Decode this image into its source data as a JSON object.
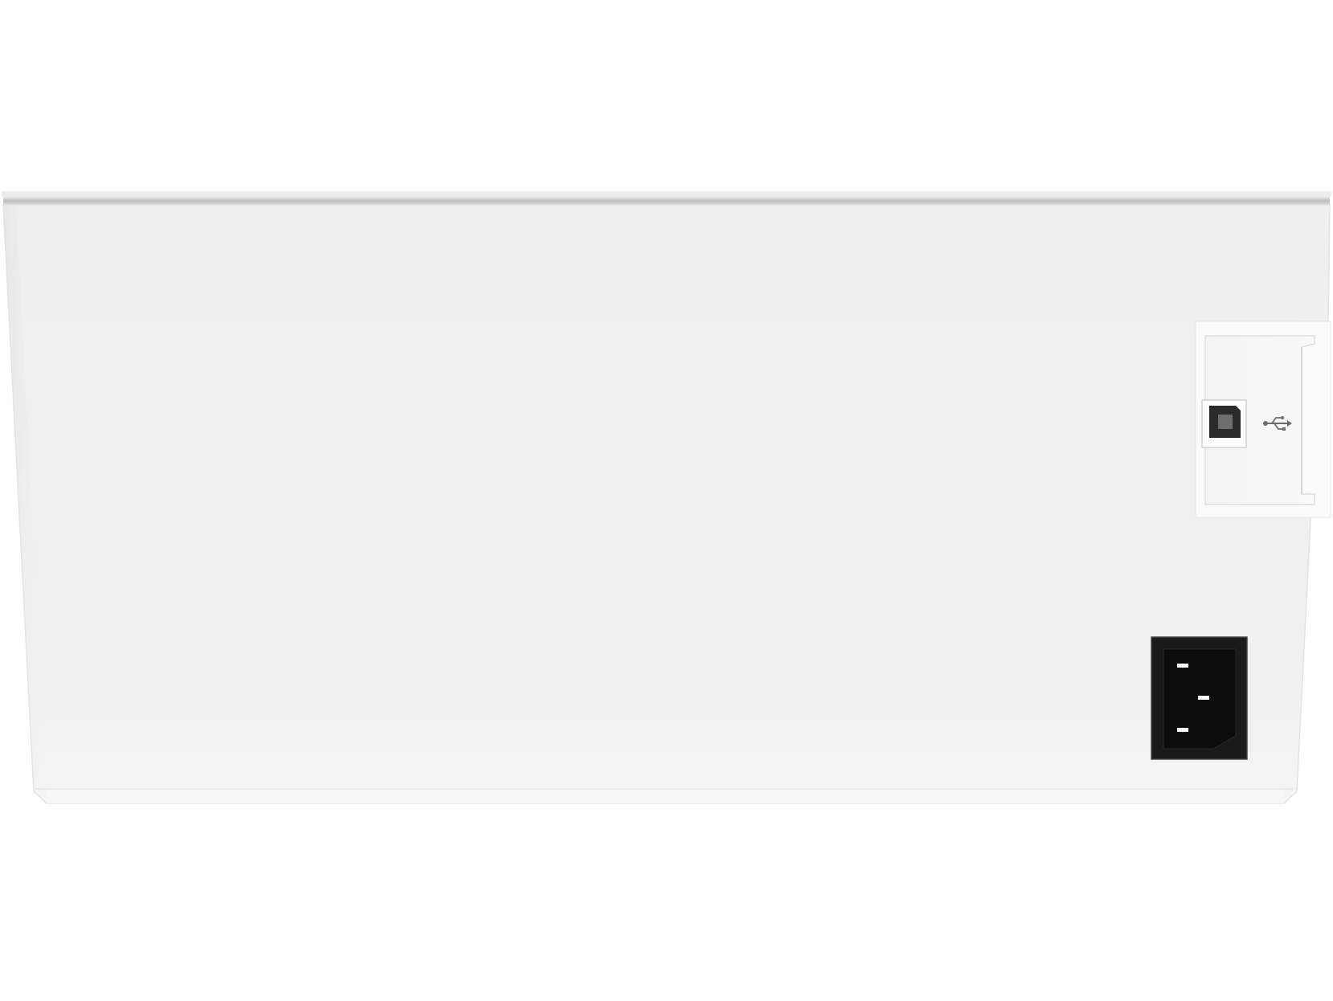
{
  "scene": {
    "subject": "printer-rear-panel",
    "background_color": "#ffffff",
    "body_color": "#f0f0f0",
    "top_edge_color": "#c9c9c9",
    "power_inlet_color": "#1a1a1a",
    "icons": {
      "usb_port": "usb-b-port-icon",
      "usb_symbol": "usb-symbol-icon",
      "power_inlet": "power-inlet-icon"
    }
  }
}
